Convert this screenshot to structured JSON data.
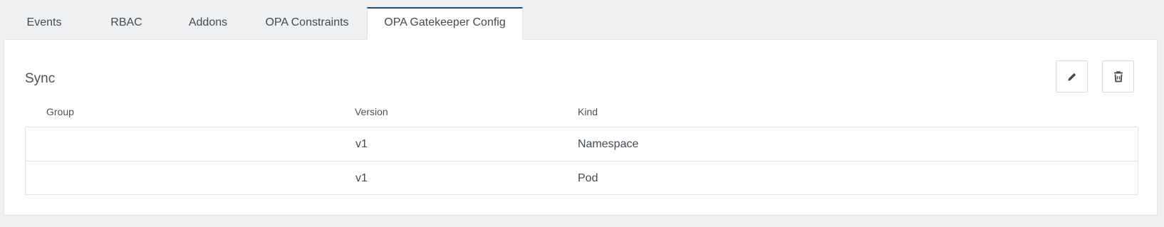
{
  "tabs": [
    {
      "label": "Events",
      "active": false
    },
    {
      "label": "RBAC",
      "active": false
    },
    {
      "label": "Addons",
      "active": false
    },
    {
      "label": "OPA Constraints",
      "active": false
    },
    {
      "label": "OPA Gatekeeper Config",
      "active": true
    }
  ],
  "section": {
    "title": "Sync"
  },
  "actions": {
    "edit_icon": "pencil-icon",
    "delete_icon": "trash-icon"
  },
  "table": {
    "columns": [
      "Group",
      "Version",
      "Kind"
    ],
    "rows": [
      {
        "group": "",
        "version": "v1",
        "kind": "Namespace"
      },
      {
        "group": "",
        "version": "v1",
        "kind": "Pod"
      }
    ]
  },
  "colors": {
    "active_tab_border": "#1f4e79",
    "background": "#eef0f2",
    "panel": "#ffffff",
    "text": "#424a52"
  }
}
